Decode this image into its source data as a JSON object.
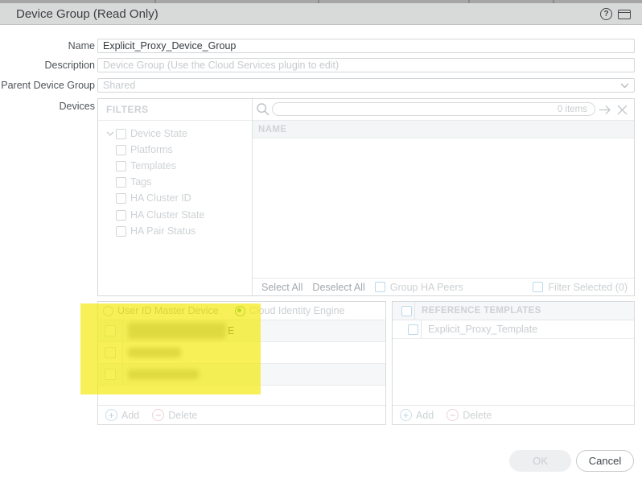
{
  "title": "Device Group (Read Only)",
  "colors": {
    "highlight_yellow": "#f4ea16",
    "radio_selected_green": "#3fa54b",
    "checkbox_blue_border": "#bcd9ea",
    "titlebar_gray": "#d8d9d9"
  },
  "form": {
    "name": {
      "label": "Name",
      "value": "Explicit_Proxy_Device_Group"
    },
    "description": {
      "label": "Description",
      "placeholder": "Device Group (Use the Cloud Services plugin to edit)"
    },
    "parent_device_group": {
      "label": "Parent Device Group",
      "value": "Shared"
    },
    "devices": {
      "label": "Devices"
    }
  },
  "devices_panel": {
    "filters": {
      "header": "FILTERS",
      "items": [
        "Device State",
        "Platforms",
        "Templates",
        "Tags",
        "HA Cluster ID",
        "HA Cluster State",
        "HA Pair Status"
      ]
    },
    "search": {
      "count_text": "0 items"
    },
    "list": {
      "name_column": "NAME"
    },
    "footer": {
      "select_all": "Select All",
      "deselect_all": "Deselect All",
      "group_ha_peers": "Group HA Peers",
      "filter_selected": "Filter Selected (0)"
    }
  },
  "master_device_panel": {
    "radio_user_id": "User ID Master Device",
    "radio_cloud_identity": "Cloud Identity Engine",
    "selected_radio": "Cloud Identity Engine",
    "rows": [
      {
        "redacted": true,
        "visible_suffix": "E"
      },
      {
        "redacted": true,
        "visible_suffix": ""
      },
      {
        "redacted": true,
        "visible_suffix": ""
      }
    ],
    "add_label": "Add",
    "delete_label": "Delete"
  },
  "reference_templates_panel": {
    "header": "REFERENCE TEMPLATES",
    "rows": [
      {
        "name": "Explicit_Proxy_Template"
      }
    ],
    "add_label": "Add",
    "delete_label": "Delete"
  },
  "actions": {
    "ok": "OK",
    "cancel": "Cancel"
  }
}
